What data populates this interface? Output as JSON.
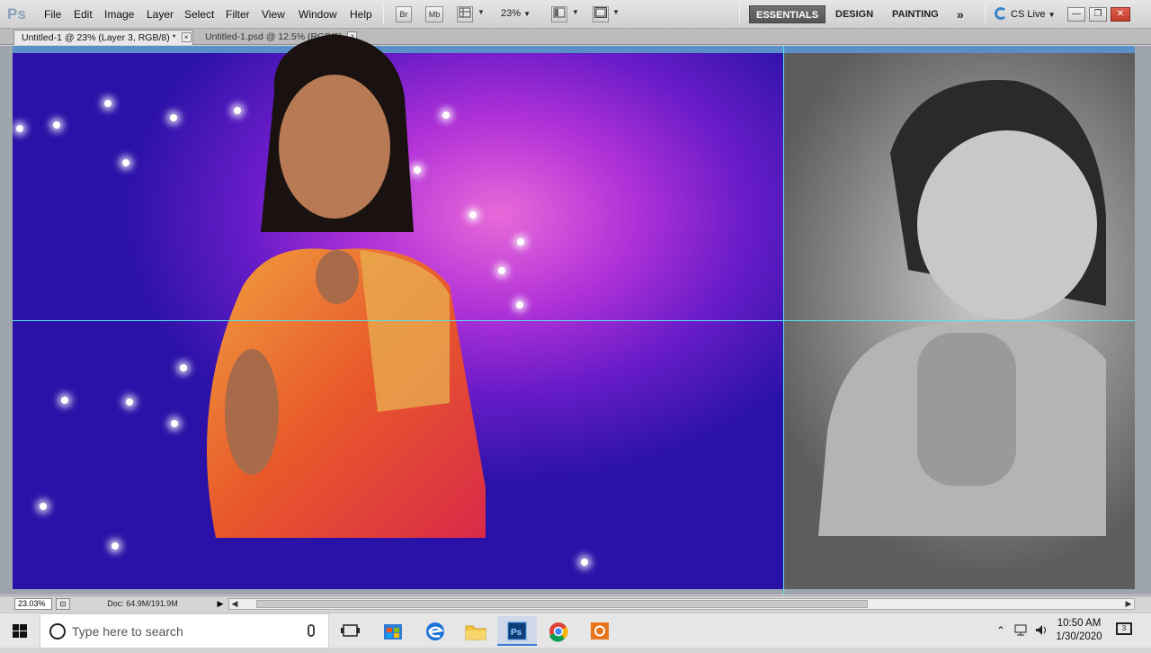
{
  "app": {
    "logo": "Ps"
  },
  "menu": [
    "File",
    "Edit",
    "Image",
    "Layer",
    "Select",
    "Filter",
    "View",
    "Window",
    "Help"
  ],
  "toolbar": {
    "bridge_label": "Br",
    "minibridge_label": "Mb",
    "zoom_value": "23%"
  },
  "workspaces": {
    "essentials": "ESSENTIALS",
    "design": "DESIGN",
    "painting": "PAINTING",
    "more": "»"
  },
  "cs_live": "CS Live",
  "tabs": [
    {
      "label": "Untitled-1 @ 23% (Layer 3, RGB/8) *",
      "close": "×"
    },
    {
      "label": "Untitled-1.psd @ 12.5% (RGB/8)",
      "close": "×"
    }
  ],
  "statusbar": {
    "zoom": "23.03%",
    "doc_info": "Doc: 64.9M/191.9M",
    "play": "▶",
    "left_arrow": "◀",
    "right_arrow": "▶"
  },
  "taskbar": {
    "search_placeholder": "Type here to search",
    "time": "10:50 AM",
    "date": "1/30/2020",
    "notifications": "3"
  },
  "colors": {
    "accent": "#3a7bd5",
    "guide": "#58e0ef",
    "canvas_purple": "#6a1cc8"
  }
}
